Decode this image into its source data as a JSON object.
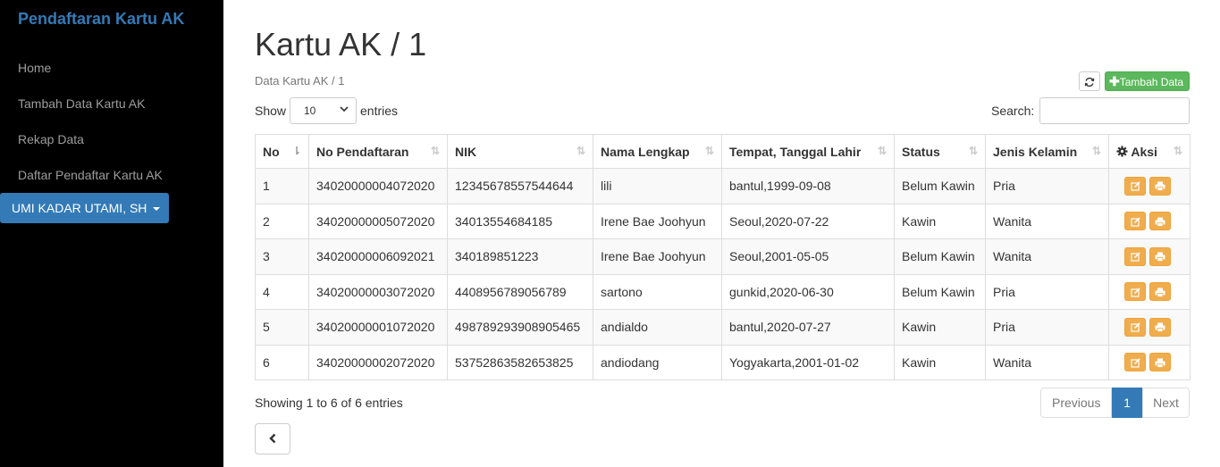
{
  "sidebar": {
    "brand": "Pendaftaran Kartu AK",
    "items": [
      {
        "label": "Home"
      },
      {
        "label": "Tambah Data Kartu AK"
      },
      {
        "label": "Rekap Data"
      },
      {
        "label": "Daftar Pendaftar Kartu AK"
      }
    ],
    "user": "UMI KADAR UTAMI, SH"
  },
  "header": {
    "title": "Kartu AK / 1",
    "subtitle": "Data Kartu AK / 1",
    "add_label": "Tambah Data"
  },
  "controls": {
    "show_label": "Show",
    "entries_value": "10",
    "entries_label": "entries",
    "search_label": "Search:",
    "search_value": ""
  },
  "table": {
    "columns": [
      "No",
      "No Pendaftaran",
      "NIK",
      "Nama Lengkap",
      "Tempat, Tanggal Lahir",
      "Status",
      "Jenis Kelamin",
      "Aksi"
    ],
    "rows": [
      [
        "1",
        "34020000004072020",
        "12345678557544644",
        "lili",
        "bantul,1999-09-08",
        "Belum Kawin",
        "Pria"
      ],
      [
        "2",
        "34020000005072020",
        "34013554684185",
        "Irene Bae Joohyun",
        "Seoul,2020-07-22",
        "Kawin",
        "Wanita"
      ],
      [
        "3",
        "34020000006092021",
        "340189851223",
        "Irene Bae Joohyun",
        "Seoul,2001-05-05",
        "Belum Kawin",
        "Wanita"
      ],
      [
        "4",
        "34020000003072020",
        "4408956789056789",
        "sartono",
        "gunkid,2020-06-30",
        "Belum Kawin",
        "Pria"
      ],
      [
        "5",
        "34020000001072020",
        "498789293908905465",
        "andialdo",
        "bantul,2020-07-27",
        "Kawin",
        "Pria"
      ],
      [
        "6",
        "34020000002072020",
        "53752863582653825",
        "andiodang",
        "Yogyakarta,2001-01-02",
        "Kawin",
        "Wanita"
      ]
    ]
  },
  "footer": {
    "info": "Showing 1 to 6 of 6 entries",
    "prev_label": "Previous",
    "current_page": "1",
    "next_label": "Next"
  },
  "colors": {
    "brand": "#337ab7",
    "success": "#5cb85c",
    "warning": "#f0ad4e",
    "sidebar_bg": "#000000"
  }
}
